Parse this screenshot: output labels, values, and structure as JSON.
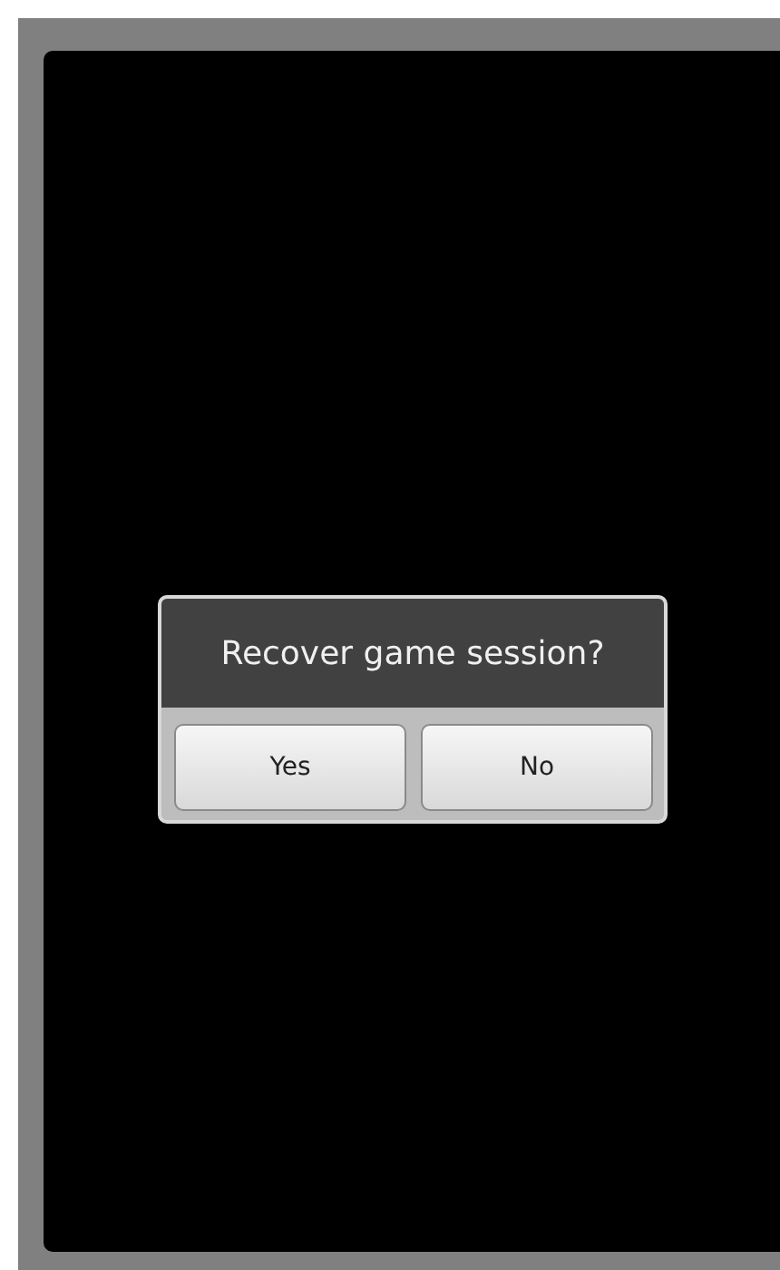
{
  "dialog": {
    "title": "Recover game session?",
    "buttons": [
      "Yes",
      "No"
    ]
  }
}
